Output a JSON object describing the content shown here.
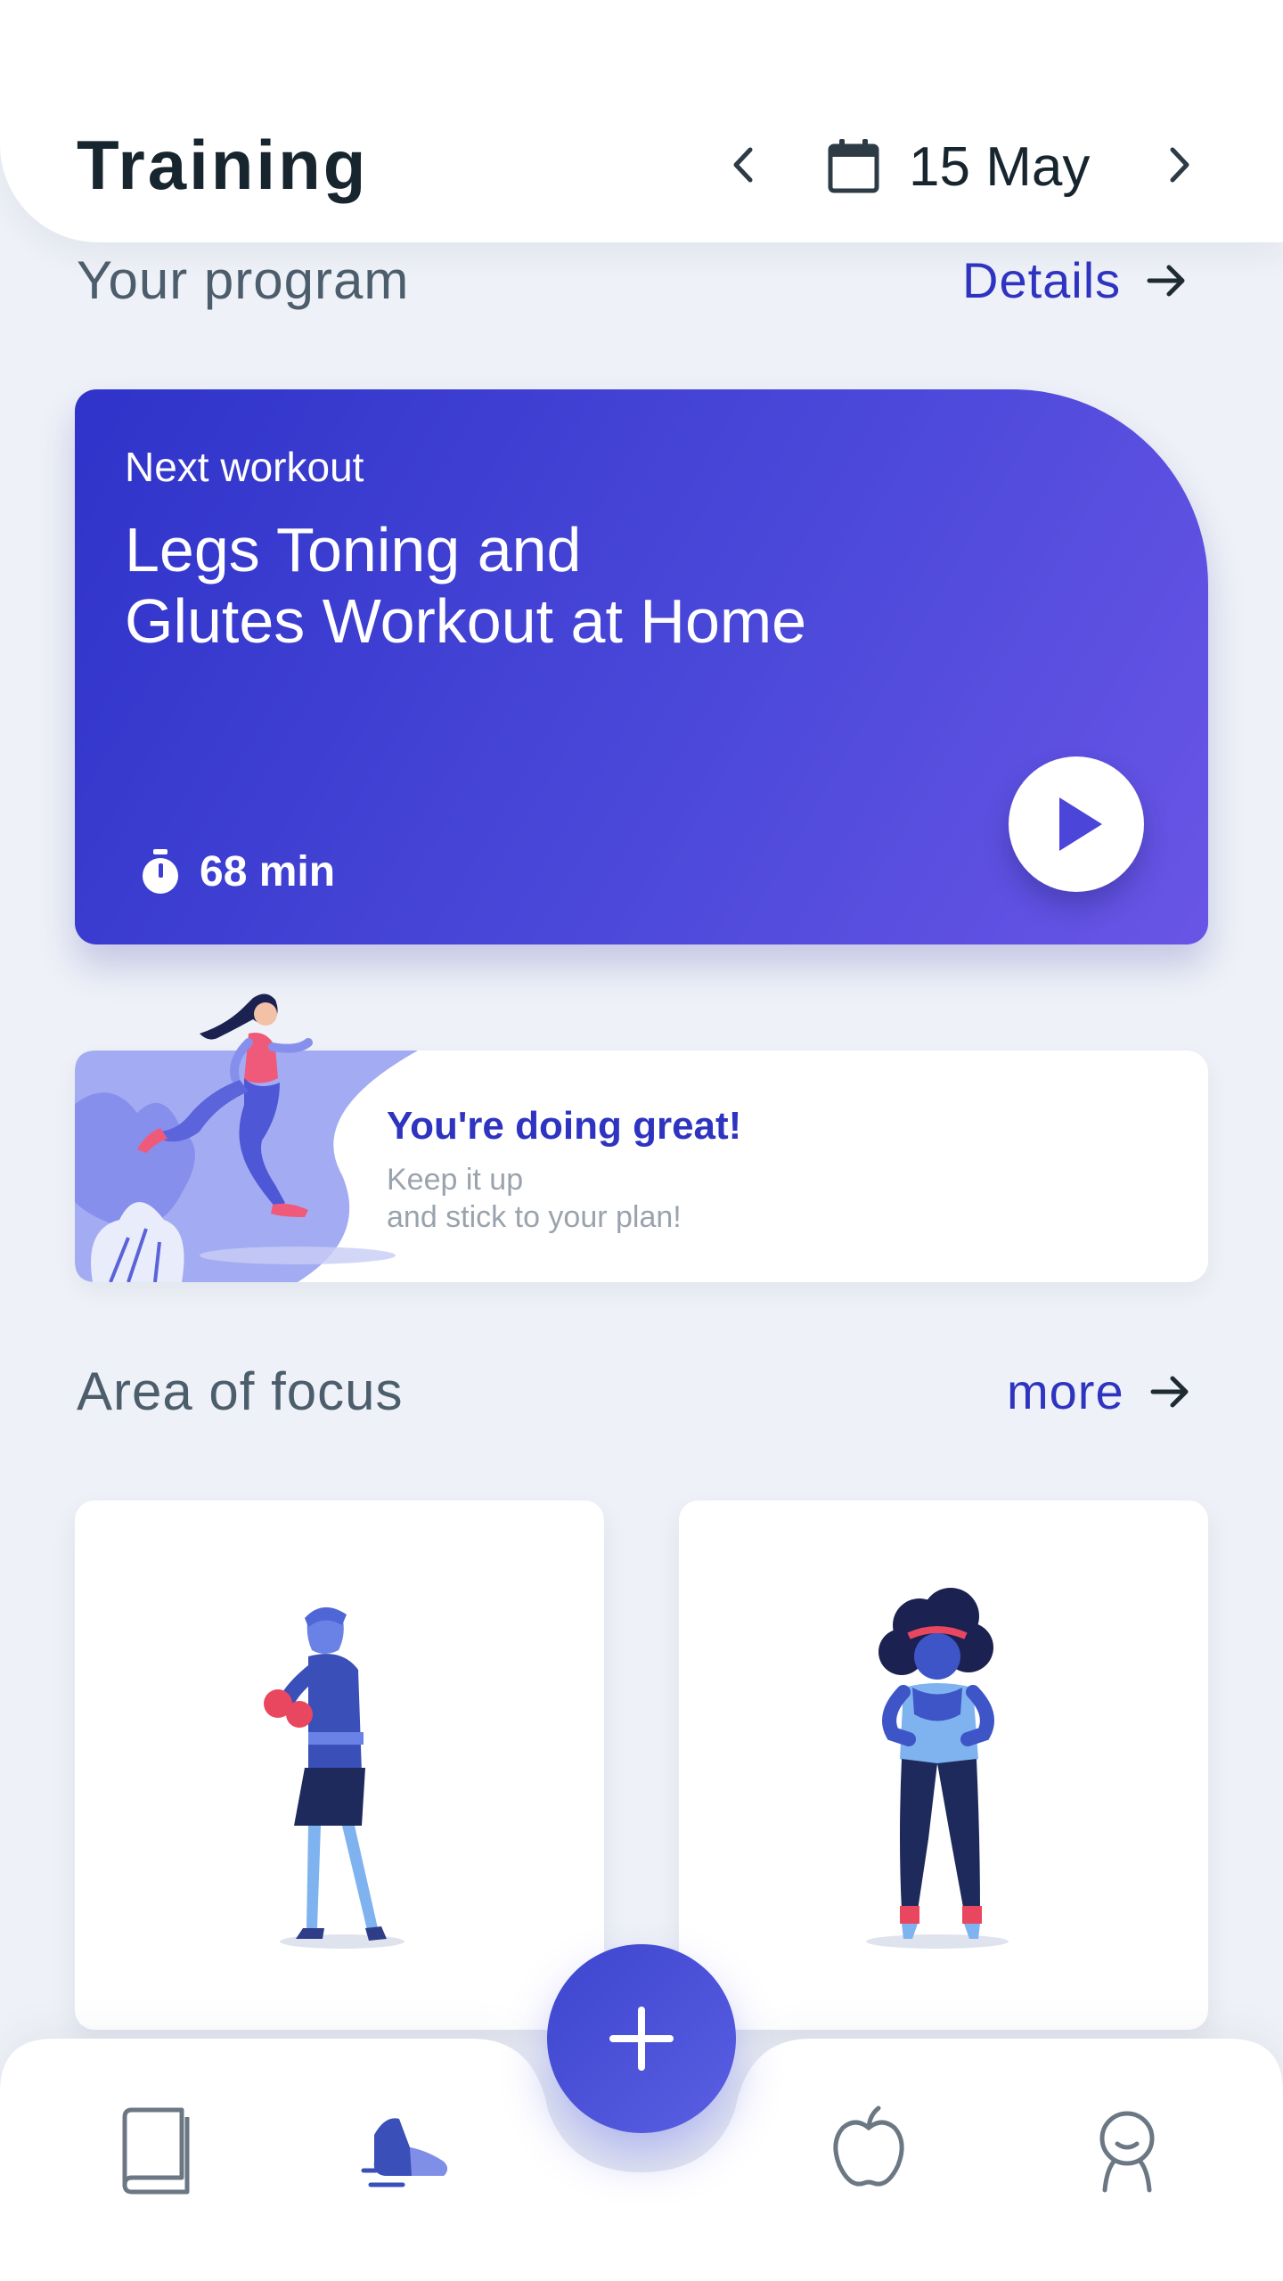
{
  "header": {
    "title": "Training",
    "date": "15 May",
    "prev_icon": "chevron-left-icon",
    "next_icon": "chevron-right-icon",
    "calendar_icon": "calendar-icon"
  },
  "program": {
    "section_title": "Your program",
    "link_label": "Details",
    "card": {
      "label": "Next workout",
      "title_line1": "Legs Toning and",
      "title_line2": "Glutes Workout at Home",
      "duration": "68 min",
      "timer_icon": "stopwatch-icon",
      "play_icon": "play-icon"
    }
  },
  "motivation": {
    "title": "You're doing great!",
    "subtitle_line1": "Keep it up",
    "subtitle_line2": "and stick to your plan!"
  },
  "focus": {
    "section_title": "Area of focus",
    "link_label": "more",
    "cards": [
      {
        "illustration": "boxing-figure"
      },
      {
        "illustration": "woman-figure"
      }
    ]
  },
  "bottom_nav": {
    "items": [
      "book-icon",
      "sneaker-icon",
      "plus-icon",
      "apple-icon",
      "profile-icon"
    ],
    "active": "sneaker-icon"
  },
  "colors": {
    "accent": "#2f34c0",
    "card_gradient_start": "#2f33c9",
    "card_gradient_end": "#6955e6",
    "background": "#eef1f7",
    "heading": "#17252e",
    "muted": "#9aa3ad"
  }
}
